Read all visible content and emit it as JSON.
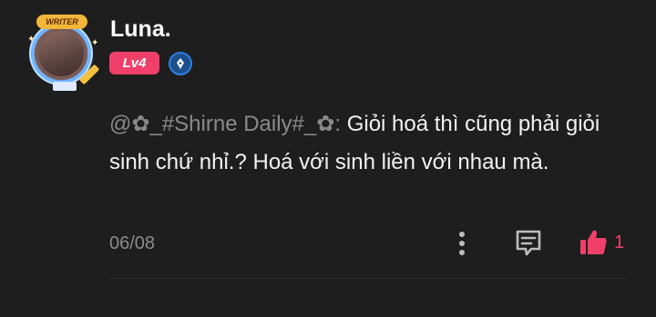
{
  "comment": {
    "username": "Luna.",
    "level_badge": "Lv4",
    "avatar_frame_label": "WRITER",
    "mention": "@✿_#Shirne Daily#_✿:",
    "text": " Giỏi hoá thì cũng phải giỏi sinh chứ nhỉ.? Hoá với sinh liền với nhau mà.",
    "date": "06/08",
    "like_count": "1"
  },
  "colors": {
    "background": "#1e1e1e",
    "accent_pink": "#f0406a",
    "muted_text": "#8c8c8c",
    "badge_blue": "#2f7ee0"
  },
  "icons": {
    "more": "vertical-dots-icon",
    "reply": "comment-reply-icon",
    "like": "thumbs-up-icon",
    "pen": "fountain-pen-icon"
  }
}
